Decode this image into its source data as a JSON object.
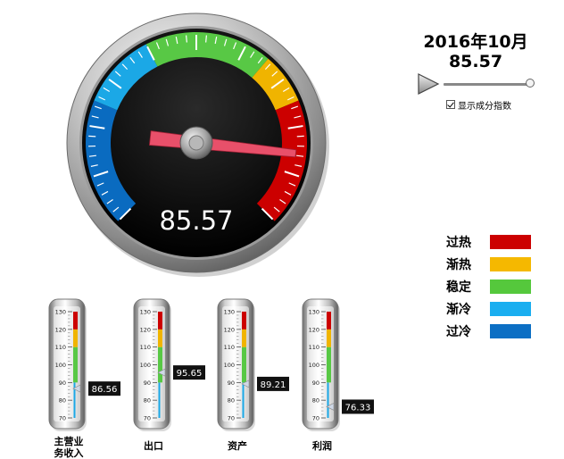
{
  "header": {
    "date_title": "2016年10月",
    "index_value": "85.57"
  },
  "controls": {
    "play_icon": "play-icon",
    "checkbox_label": "显示成分指数",
    "checkbox_checked": true,
    "slider_position_fraction": 1.0
  },
  "main_gauge": {
    "value": 85.57,
    "value_text": "85.57",
    "min": 0,
    "max": 100,
    "zones": [
      {
        "name": "过冷",
        "from": 0,
        "to": 25,
        "color": "#0a6bc0"
      },
      {
        "name": "渐冷",
        "from": 25,
        "to": 40,
        "color": "#1ba8e6"
      },
      {
        "name": "稳定",
        "from": 40,
        "to": 65,
        "color": "#58c845"
      },
      {
        "name": "渐热",
        "from": 65,
        "to": 75,
        "color": "#f0b400"
      },
      {
        "name": "过热",
        "from": 75,
        "to": 100,
        "color": "#cc0000"
      }
    ]
  },
  "legend": [
    {
      "label": "过热",
      "color": "#cc0000"
    },
    {
      "label": "渐热",
      "color": "#f5b800"
    },
    {
      "label": "稳定",
      "color": "#55c83c"
    },
    {
      "label": "渐冷",
      "color": "#1aaef0"
    },
    {
      "label": "过冷",
      "color": "#0c6fc4"
    }
  ],
  "thermometers": {
    "ticks": [
      "130",
      "120",
      "110",
      "100",
      "90",
      "80",
      "70"
    ],
    "scale_min": 70,
    "scale_max": 130,
    "zones": [
      {
        "from": 70,
        "to": 90,
        "color": "#1ba8e6"
      },
      {
        "from": 90,
        "to": 110,
        "color": "#58c845"
      },
      {
        "from": 110,
        "to": 120,
        "color": "#f0b400"
      },
      {
        "from": 120,
        "to": 130,
        "color": "#cc0000"
      }
    ],
    "items": [
      {
        "label_lines": [
          "主营业",
          "务收入"
        ],
        "value": 86.56,
        "value_text": "86.56"
      },
      {
        "label_lines": [
          "出口"
        ],
        "value": 95.65,
        "value_text": "95.65"
      },
      {
        "label_lines": [
          "资产"
        ],
        "value": 89.21,
        "value_text": "89.21"
      },
      {
        "label_lines": [
          "利润"
        ],
        "value": 76.33,
        "value_text": "76.33"
      }
    ]
  }
}
